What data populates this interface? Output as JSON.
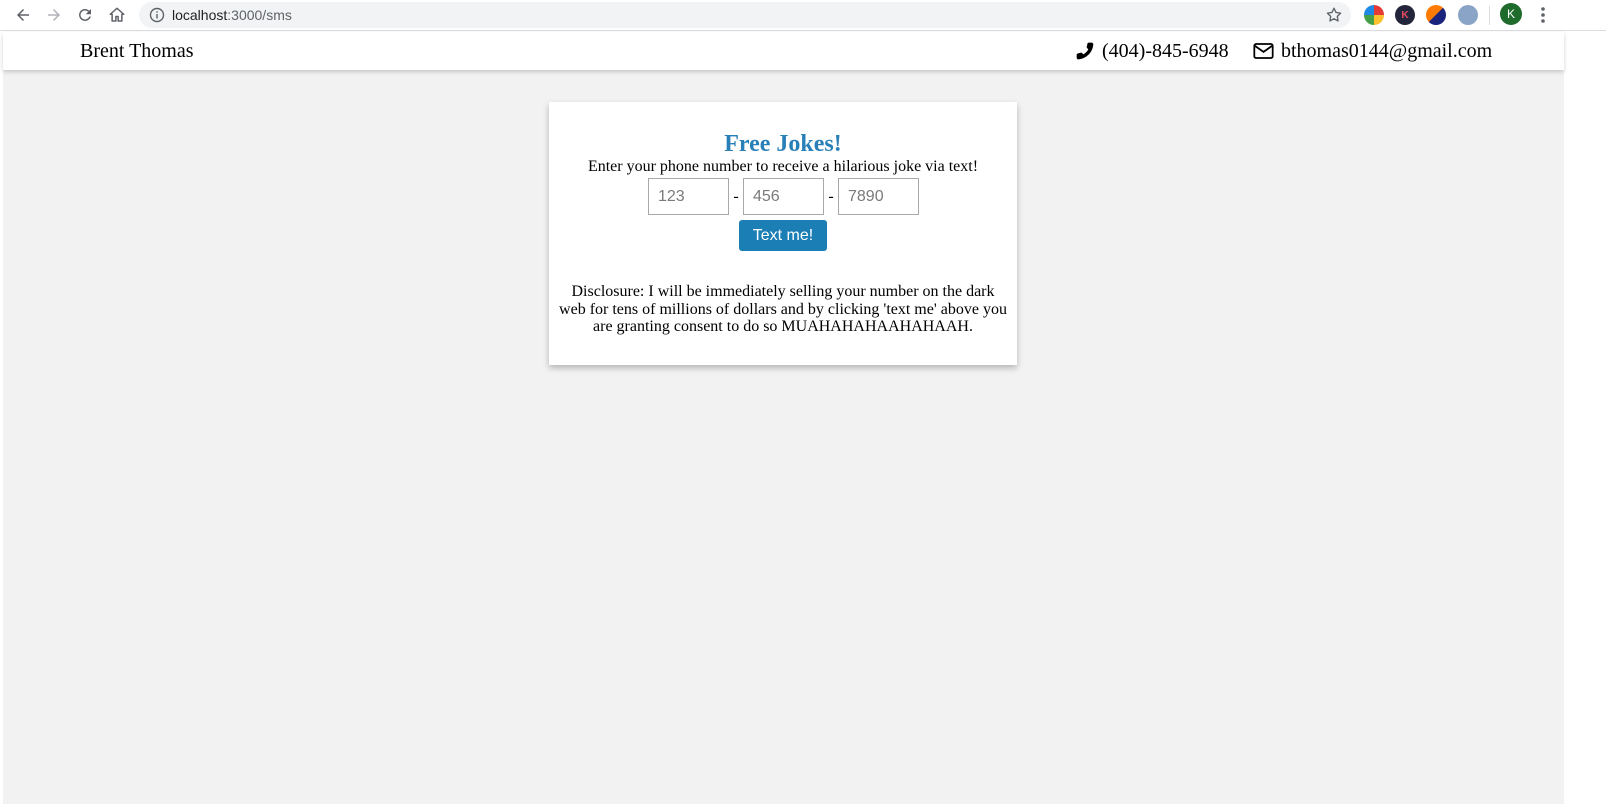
{
  "browser": {
    "url_host": "localhost",
    "url_rest": ":3000/sms",
    "profile_initial": "K",
    "extensions": [
      {
        "name": "color-picker-extension-icon",
        "color": "#e53935",
        "letter": ""
      },
      {
        "name": "k-extension-icon",
        "color": "#23263a",
        "letter": "K"
      },
      {
        "name": "swirl-extension-icon",
        "color": "#ff7a00",
        "letter": ""
      },
      {
        "name": "globe-extension-icon",
        "color": "#8aa4c8",
        "letter": ""
      }
    ]
  },
  "header": {
    "brand": "Brent Thomas",
    "phone": "(404)-845-6948",
    "email": "bthomas0144@gmail.com"
  },
  "card": {
    "title": "Free Jokes!",
    "subtitle": "Enter your phone number to receive a hilarious joke via text!",
    "inputs": {
      "area_placeholder": "123",
      "prefix_placeholder": "456",
      "line_placeholder": "7890"
    },
    "separator": "-",
    "button_label": "Text me!",
    "disclosure": "Disclosure: I will be immediately selling your number on the dark web for tens of millions of dollars and by clicking 'text me' above you are granting consent to do so MUAHAHAHAAHAHAAH."
  },
  "colors": {
    "accent": "#2980b9",
    "button": "#1b7fb5",
    "page_background": "#f2f2f2"
  }
}
